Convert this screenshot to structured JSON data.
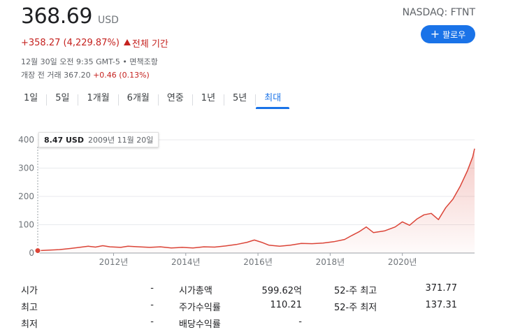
{
  "quote": {
    "price": "368.69",
    "currency": "USD",
    "ticker": "NASDAQ: FTNT",
    "follow_label": "팔로우",
    "change": "+358.27 (4,229.87%)",
    "change_period": "전체 기간",
    "timestamp": "12월 30일 오전 9:35 GMT-5 • 면책조항",
    "after_hours_prefix": "개장 전 거래 367.20",
    "after_hours_change": "+0.46 (0.13%)"
  },
  "colors": {
    "accent": "#1a73e8",
    "negative_up": "#c5221f",
    "line": "#db4437"
  },
  "tabs": [
    {
      "label": "1일"
    },
    {
      "label": "5일"
    },
    {
      "label": "1개월"
    },
    {
      "label": "6개월"
    },
    {
      "label": "연중"
    },
    {
      "label": "1년"
    },
    {
      "label": "5년"
    },
    {
      "label": "최대",
      "active": true
    }
  ],
  "tooltip": {
    "value": "8.47 USD",
    "date": "2009년 11월 20일"
  },
  "chart_data": {
    "type": "area",
    "x_tick_labels": [
      "2012년",
      "2014년",
      "2016년",
      "2018년",
      "2020년"
    ],
    "y_tick_labels": [
      "0",
      "100",
      "200",
      "300",
      "400"
    ],
    "ylim": [
      0,
      400
    ],
    "xlim": [
      2009.9,
      2022.0
    ],
    "grid": true,
    "series": [
      {
        "x": [
          2009.9,
          2010.2,
          2010.5,
          2010.8,
          2011.0,
          2011.3,
          2011.5,
          2011.7,
          2011.9,
          2012.2,
          2012.4,
          2012.7,
          2013.0,
          2013.3,
          2013.6,
          2013.9,
          2014.2,
          2014.5,
          2014.8,
          2015.1,
          2015.4,
          2015.7,
          2015.9,
          2016.1,
          2016.3,
          2016.6,
          2016.9,
          2017.2,
          2017.5,
          2017.8,
          2018.1,
          2018.4,
          2018.6,
          2018.8,
          2019.0,
          2019.2,
          2019.5,
          2019.8,
          2020.0,
          2020.2,
          2020.4,
          2020.6,
          2020.8,
          2021.0,
          2021.2,
          2021.4,
          2021.6,
          2021.8,
          2021.95,
          2022.0
        ],
        "y": [
          8.47,
          10,
          12,
          16,
          19,
          24,
          21,
          26,
          22,
          20,
          24,
          22,
          20,
          22,
          18,
          20,
          18,
          22,
          21,
          25,
          30,
          38,
          46,
          38,
          28,
          24,
          28,
          34,
          33,
          35,
          40,
          48,
          62,
          75,
          92,
          72,
          78,
          92,
          110,
          98,
          120,
          135,
          140,
          118,
          160,
          190,
          235,
          290,
          340,
          368.69
        ]
      }
    ]
  },
  "stats": {
    "rows": [
      [
        {
          "label": "시가",
          "value": "-"
        },
        {
          "label": "시가총액",
          "value": "599.62억"
        },
        {
          "label": "52-주 최고",
          "value": "371.77"
        }
      ],
      [
        {
          "label": "최고",
          "value": "-"
        },
        {
          "label": "주가수익률",
          "value": "110.21"
        },
        {
          "label": "52-주 최저",
          "value": "137.31"
        }
      ],
      [
        {
          "label": "최저",
          "value": "-"
        },
        {
          "label": "배당수익률",
          "value": "-"
        }
      ]
    ]
  }
}
